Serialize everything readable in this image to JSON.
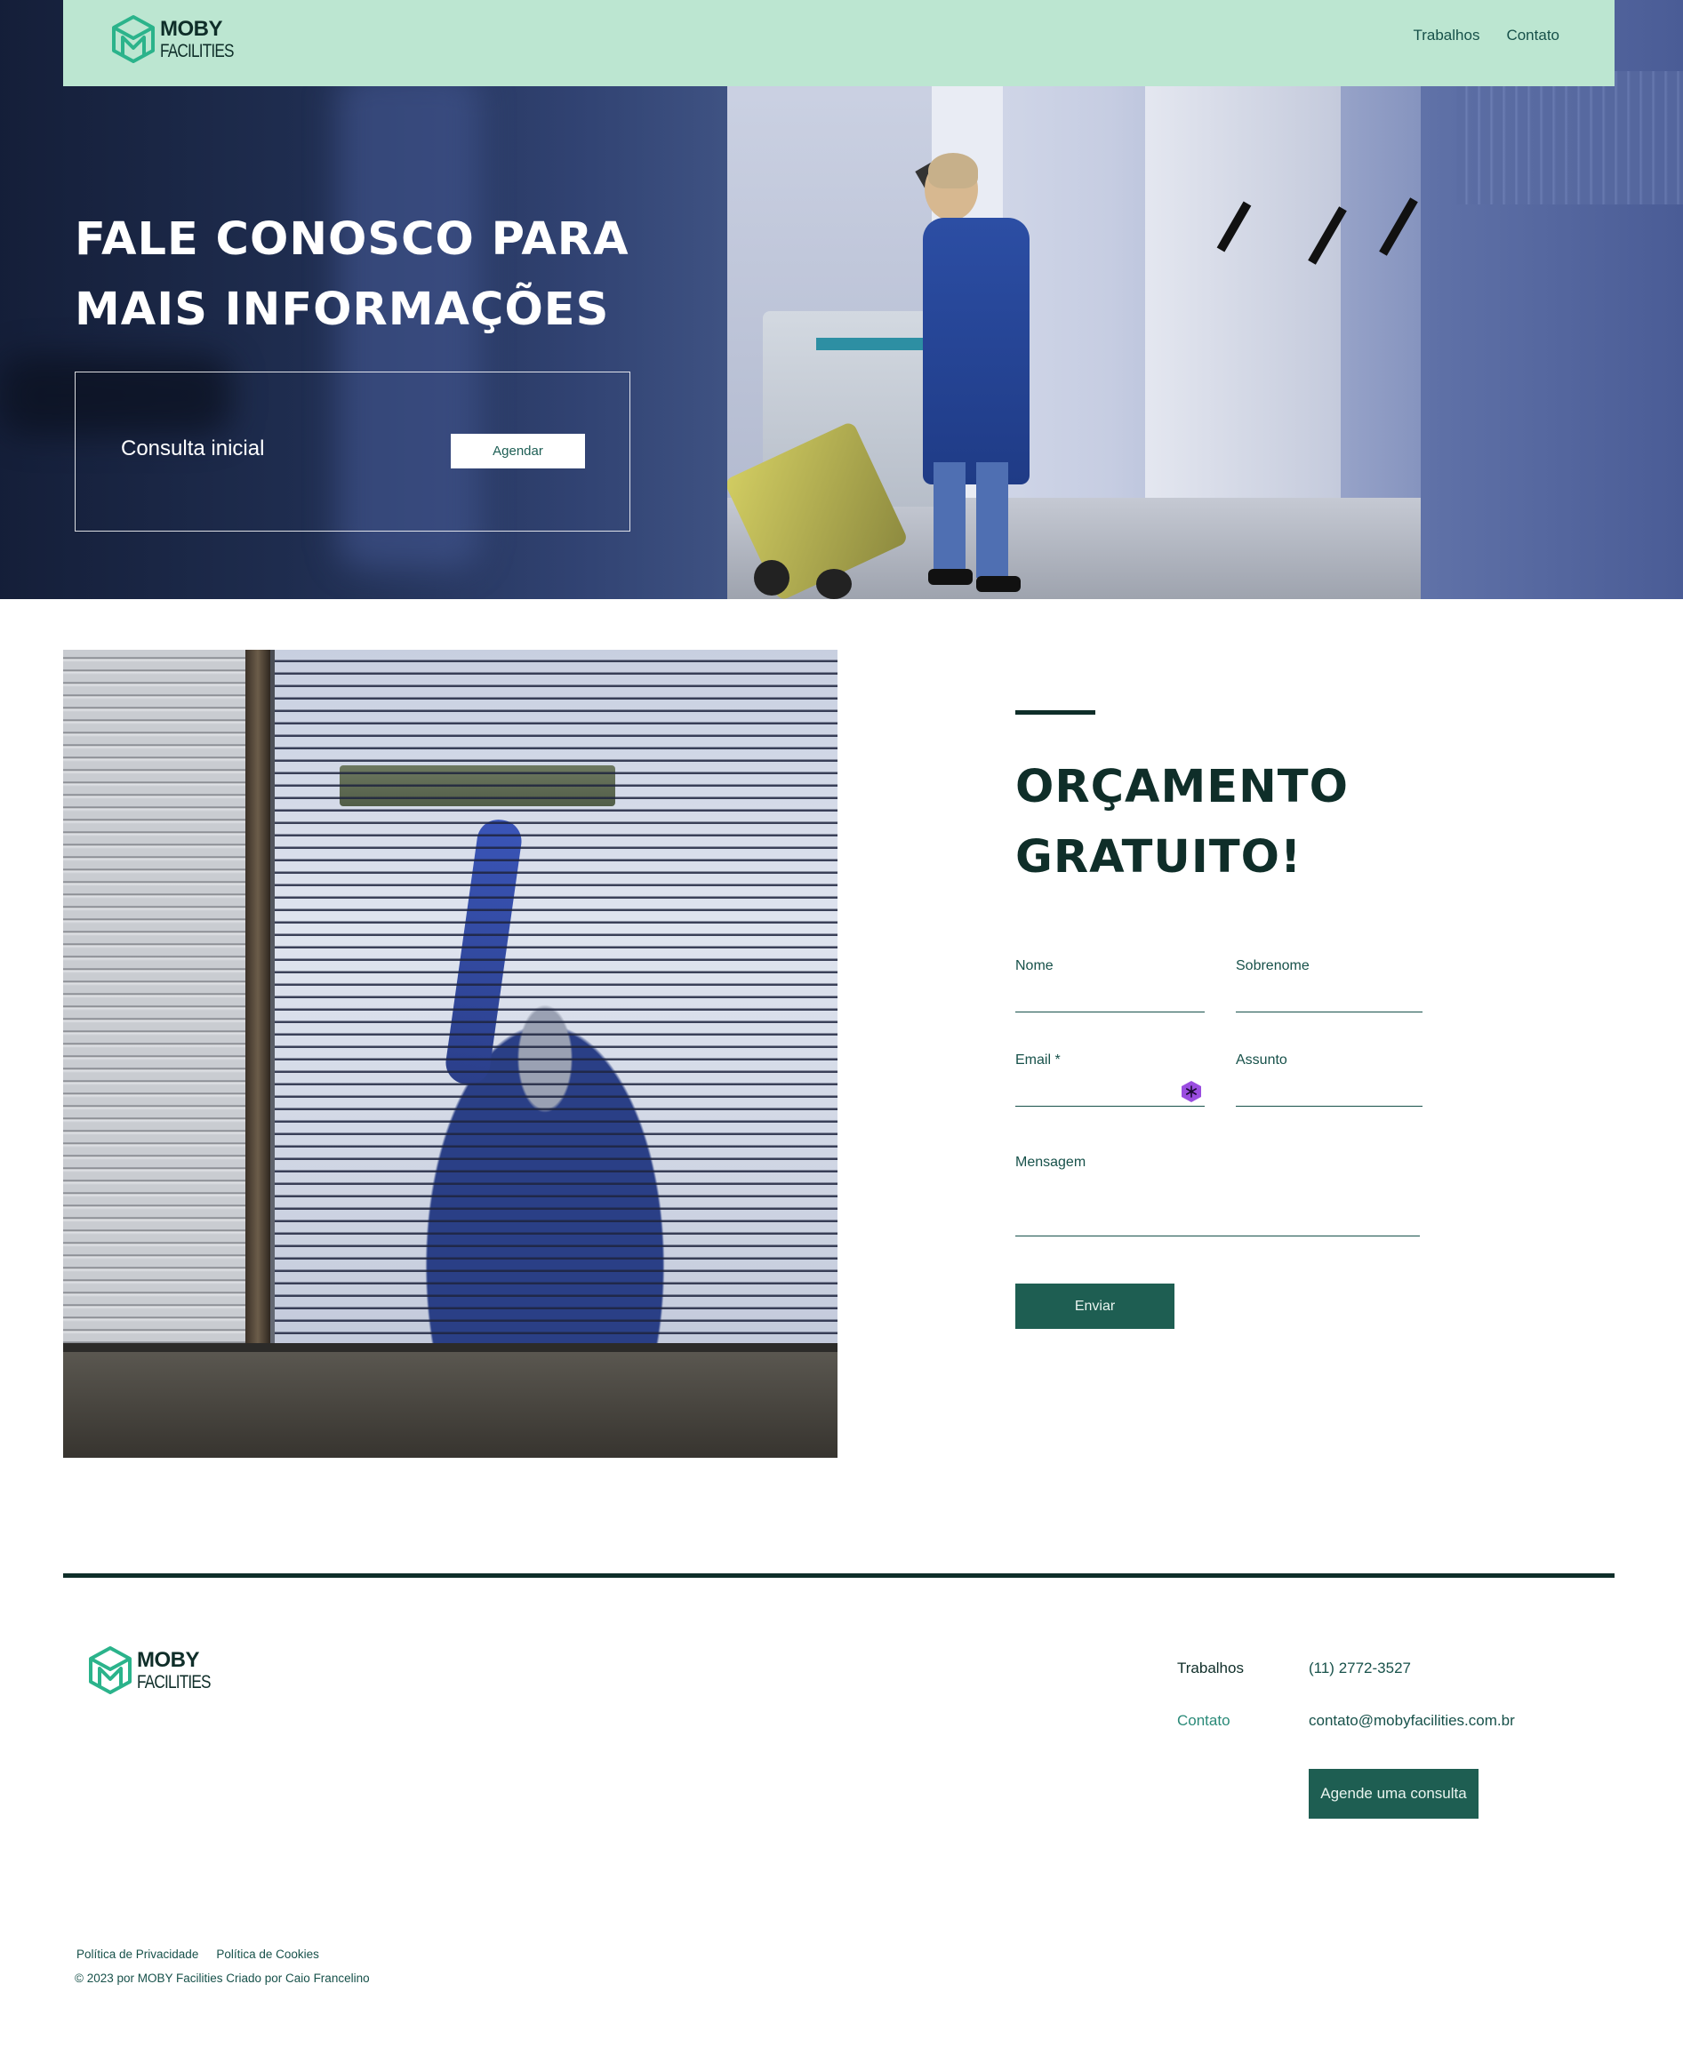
{
  "brand": {
    "word1": "MOBY",
    "word2": "FACILITIES",
    "color_primary": "#1e5e52",
    "color_dark": "#0f2e29",
    "color_header": "#bce6d1",
    "logo_green": "#2bb38b"
  },
  "nav": {
    "items": [
      "Trabalhos",
      "Contato"
    ]
  },
  "hero": {
    "title_line1": "FALE CONOSCO PARA",
    "title_line2": "MAIS INFORMAÇÕES",
    "consult_label": "Consulta inicial",
    "consult_button": "Agendar"
  },
  "quote": {
    "title_line1": "ORÇAMENTO",
    "title_line2": "GRATUITO!",
    "fields": {
      "first_name": "Nome",
      "last_name": "Sobrenome",
      "email": "Email *",
      "subject": "Assunto",
      "message": "Mensagem"
    },
    "submit": "Enviar"
  },
  "footer": {
    "links": [
      "Trabalhos",
      "Contato"
    ],
    "phone": "(11) 2772-3527",
    "email": "contato@mobyfacilities.com.br",
    "cta": "Agende uma consulta",
    "privacy": "Política de Privacidade",
    "cookies": "Política de Cookies",
    "copyright": "© 2023 por MOBY Facilities Criado por Caio Francelino"
  }
}
